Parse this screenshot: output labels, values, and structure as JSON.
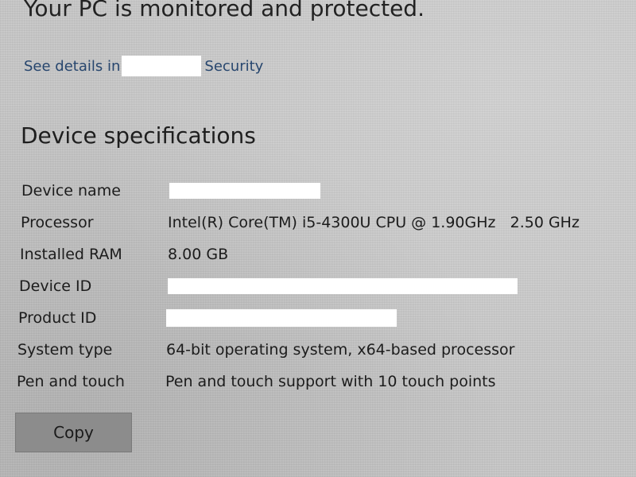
{
  "header": {
    "status_text": "Your PC is monitored and protected.",
    "details_link_prefix": "See details in",
    "details_link_suffix": "Security"
  },
  "device_specifications": {
    "title": "Device specifications",
    "rows": [
      {
        "label": "Device name",
        "value": "",
        "redacted": true
      },
      {
        "label": "Processor",
        "value": "Intel(R) Core(TM) i5-4300U CPU @ 1.90GHz   2.50 GHz",
        "redacted": false
      },
      {
        "label": "Installed RAM",
        "value": "8.00 GB",
        "redacted": false
      },
      {
        "label": "Device ID",
        "value": "",
        "redacted": true
      },
      {
        "label": "Product ID",
        "value": "",
        "redacted": true
      },
      {
        "label": "System type",
        "value": "64-bit operating system, x64-based processor",
        "redacted": false
      },
      {
        "label": "Pen and touch",
        "value": "Pen and touch support with 10 touch points",
        "redacted": false
      }
    ]
  },
  "actions": {
    "copy_label": "Copy"
  },
  "colors": {
    "background": "#c9c9c9",
    "link": "#27466e",
    "button": "#8c8c8c",
    "redaction": "#ffffff"
  }
}
